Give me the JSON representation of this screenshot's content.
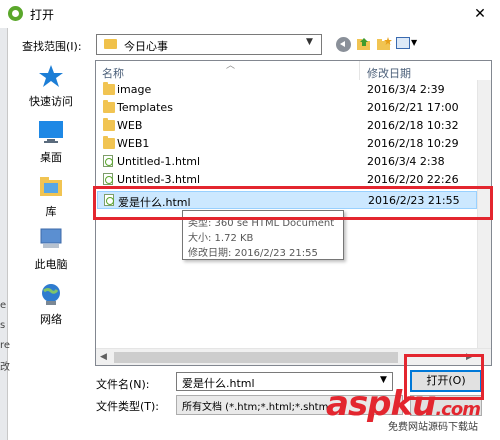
{
  "window": {
    "title": "打开",
    "close_glyph": "✕"
  },
  "background_edge": [
    "e",
    "s",
    "re",
    "改"
  ],
  "toolbar": {
    "lookin_label": "查找范围(I):",
    "lookin_value": "今日心事",
    "icons": [
      "back-icon",
      "up-folder-icon",
      "new-folder-icon",
      "views-icon"
    ]
  },
  "places": [
    {
      "label": "快速访问",
      "icon": "star-icon",
      "color": "#1c7ed6"
    },
    {
      "label": "桌面",
      "icon": "desktop-icon",
      "color": "#1e88e5"
    },
    {
      "label": "库",
      "icon": "library-icon",
      "color": "#f1c452"
    },
    {
      "label": "此电脑",
      "icon": "computer-icon",
      "color": "#5b8fd1"
    },
    {
      "label": "网络",
      "icon": "network-icon",
      "color": "#2e7bcf"
    }
  ],
  "columns": {
    "name": "名称",
    "date": "修改日期"
  },
  "files": [
    {
      "name": "image",
      "date": "2016/3/4 2:39",
      "type": "folder"
    },
    {
      "name": "Templates",
      "date": "2016/2/21 17:00",
      "type": "folder"
    },
    {
      "name": "WEB",
      "date": "2016/2/18 10:32",
      "type": "folder"
    },
    {
      "name": "WEB1",
      "date": "2016/2/18 10:29",
      "type": "folder"
    },
    {
      "name": "Untitled-1.html",
      "date": "2016/3/4 2:38",
      "type": "html"
    },
    {
      "name": "Untitled-3.html",
      "date": "2016/2/20 22:26",
      "type": "html"
    },
    {
      "name": "爱是什么.html",
      "date": "2016/2/23 21:55",
      "type": "html",
      "selected": true
    }
  ],
  "tooltip": {
    "type_line": "类型: 360 se HTML Document",
    "size_line": "大小: 1.72 KB",
    "date_line": "修改日期: 2016/2/23 21:55"
  },
  "bottom": {
    "filename_label": "文件名(N):",
    "filename_value": "爱是什么.html",
    "filetype_label": "文件类型(T):",
    "filetype_value": "所有文档 (*.htm;*.html;*.shtm",
    "open_label": "打开(O)"
  },
  "watermark": {
    "text": "aspku",
    "suffix": ".com",
    "subtext": "免费网站源码下载站"
  },
  "colors": {
    "highlight": "#e3262f",
    "selection": "#cce8ff",
    "accent": "#0078d7"
  }
}
